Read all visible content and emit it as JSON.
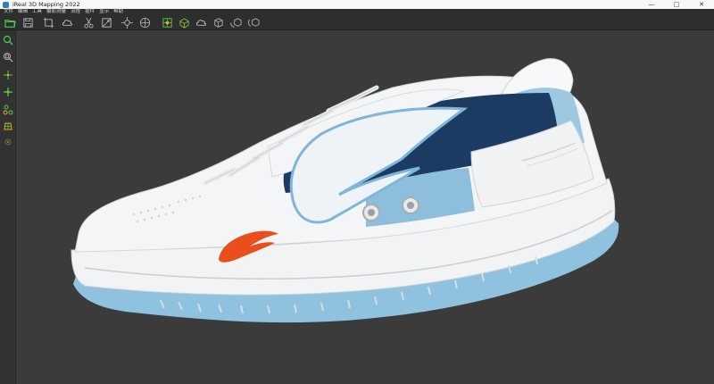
{
  "window": {
    "title": "iReal 3D Mapping 2022"
  },
  "menu": {
    "items": [
      "文件",
      "编辑",
      "工具",
      "摄影测量",
      "流程",
      "插件",
      "显示",
      "帮助"
    ]
  },
  "toolbar": {
    "icons": [
      "open-folder-icon",
      "save-icon",
      "crop-icon",
      "cloud-icon",
      "scissors-icon",
      "texture-icon",
      "target-icon",
      "align-icon",
      "mesh-icon",
      "scan-icon",
      "cloud-point-icon",
      "cube-icon",
      "rotate-cube-icon",
      "rotate-cube-2-icon"
    ]
  },
  "sidebar": {
    "icons": [
      "zoom-icon",
      "zoom-fit-icon",
      "crosshair-icon",
      "crosshair-add-icon",
      "node-link-icon",
      "grid-box-icon",
      "point-icon"
    ]
  },
  "colors": {
    "accent": "#f5a623",
    "active_icon": "#4cd04c",
    "background": "#3b3b3b",
    "toolbar": "#2e2e2e"
  }
}
